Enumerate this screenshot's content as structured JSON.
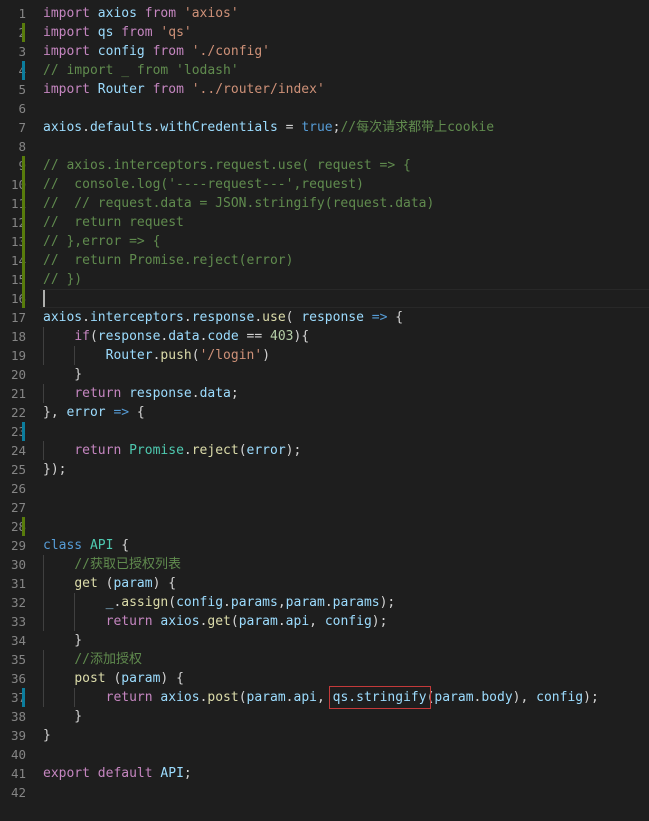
{
  "editor": {
    "lines": [
      {
        "n": "1",
        "marker": "",
        "tokens": [
          {
            "t": "import",
            "c": "kw"
          },
          {
            "t": " "
          },
          {
            "t": "axios",
            "c": "var"
          },
          {
            "t": " "
          },
          {
            "t": "from",
            "c": "kw"
          },
          {
            "t": " "
          },
          {
            "t": "'axios'",
            "c": "str"
          }
        ]
      },
      {
        "n": "2",
        "marker": "add",
        "tokens": [
          {
            "t": "import",
            "c": "kw"
          },
          {
            "t": " "
          },
          {
            "t": "qs",
            "c": "var"
          },
          {
            "t": " "
          },
          {
            "t": "from",
            "c": "kw"
          },
          {
            "t": " "
          },
          {
            "t": "'qs'",
            "c": "str"
          }
        ]
      },
      {
        "n": "3",
        "marker": "",
        "tokens": [
          {
            "t": "import",
            "c": "kw"
          },
          {
            "t": " "
          },
          {
            "t": "config",
            "c": "var"
          },
          {
            "t": " "
          },
          {
            "t": "from",
            "c": "kw"
          },
          {
            "t": " "
          },
          {
            "t": "'./config'",
            "c": "str"
          }
        ]
      },
      {
        "n": "4",
        "marker": "mod",
        "tokens": [
          {
            "t": "// import _ from 'lodash'",
            "c": "cm"
          }
        ]
      },
      {
        "n": "5",
        "marker": "",
        "tokens": [
          {
            "t": "import",
            "c": "kw"
          },
          {
            "t": " "
          },
          {
            "t": "Router",
            "c": "var"
          },
          {
            "t": " "
          },
          {
            "t": "from",
            "c": "kw"
          },
          {
            "t": " "
          },
          {
            "t": "'../router/index'",
            "c": "str"
          }
        ]
      },
      {
        "n": "6",
        "marker": "",
        "tokens": []
      },
      {
        "n": "7",
        "marker": "",
        "tokens": [
          {
            "t": "axios",
            "c": "var"
          },
          {
            "t": "."
          },
          {
            "t": "defaults",
            "c": "var"
          },
          {
            "t": "."
          },
          {
            "t": "withCredentials",
            "c": "var"
          },
          {
            "t": " = "
          },
          {
            "t": "true",
            "c": "kw2"
          },
          {
            "t": ";"
          },
          {
            "t": "//每次请求都带上cookie",
            "c": "cm"
          }
        ]
      },
      {
        "n": "8",
        "marker": "",
        "tokens": []
      },
      {
        "n": "9",
        "marker": "add",
        "tokens": [
          {
            "t": "// axios.interceptors.request.use( request => {",
            "c": "cm"
          }
        ]
      },
      {
        "n": "10",
        "marker": "add",
        "tokens": [
          {
            "t": "//  console.log('----request---',request)",
            "c": "cm"
          }
        ]
      },
      {
        "n": "11",
        "marker": "add",
        "tokens": [
          {
            "t": "//  // request.data = JSON.stringify(request.data)",
            "c": "cm"
          }
        ]
      },
      {
        "n": "12",
        "marker": "add",
        "tokens": [
          {
            "t": "//  return request",
            "c": "cm"
          }
        ]
      },
      {
        "n": "13",
        "marker": "add",
        "tokens": [
          {
            "t": "// },error => {",
            "c": "cm"
          }
        ]
      },
      {
        "n": "14",
        "marker": "add",
        "tokens": [
          {
            "t": "//  return Promise.reject(error)",
            "c": "cm"
          }
        ]
      },
      {
        "n": "15",
        "marker": "add",
        "tokens": [
          {
            "t": "// })",
            "c": "cm"
          }
        ]
      },
      {
        "n": "16",
        "marker": "add",
        "current": true,
        "tokens": []
      },
      {
        "n": "17",
        "marker": "",
        "tokens": [
          {
            "t": "axios",
            "c": "var"
          },
          {
            "t": "."
          },
          {
            "t": "interceptors",
            "c": "var"
          },
          {
            "t": "."
          },
          {
            "t": "response",
            "c": "var"
          },
          {
            "t": "."
          },
          {
            "t": "use",
            "c": "fn"
          },
          {
            "t": "( "
          },
          {
            "t": "response",
            "c": "var"
          },
          {
            "t": " "
          },
          {
            "t": "=>",
            "c": "kw2"
          },
          {
            "t": " {"
          }
        ]
      },
      {
        "n": "18",
        "marker": "",
        "tokens": [
          {
            "t": "    "
          },
          {
            "t": "if",
            "c": "kw"
          },
          {
            "t": "("
          },
          {
            "t": "response",
            "c": "var"
          },
          {
            "t": "."
          },
          {
            "t": "data",
            "c": "var"
          },
          {
            "t": "."
          },
          {
            "t": "code",
            "c": "var"
          },
          {
            "t": " == "
          },
          {
            "t": "403",
            "c": "num"
          },
          {
            "t": "){"
          }
        ]
      },
      {
        "n": "19",
        "marker": "",
        "tokens": [
          {
            "t": "        "
          },
          {
            "t": "Router",
            "c": "var"
          },
          {
            "t": "."
          },
          {
            "t": "push",
            "c": "fn"
          },
          {
            "t": "("
          },
          {
            "t": "'/login'",
            "c": "str"
          },
          {
            "t": ")"
          }
        ]
      },
      {
        "n": "20",
        "marker": "",
        "tokens": [
          {
            "t": "    }"
          }
        ]
      },
      {
        "n": "21",
        "marker": "",
        "tokens": [
          {
            "t": "    "
          },
          {
            "t": "return",
            "c": "kw"
          },
          {
            "t": " "
          },
          {
            "t": "response",
            "c": "var"
          },
          {
            "t": "."
          },
          {
            "t": "data",
            "c": "var"
          },
          {
            "t": ";"
          }
        ]
      },
      {
        "n": "22",
        "marker": "",
        "tokens": [
          {
            "t": "}, "
          },
          {
            "t": "error",
            "c": "var"
          },
          {
            "t": " "
          },
          {
            "t": "=>",
            "c": "kw2"
          },
          {
            "t": " {"
          }
        ]
      },
      {
        "n": "23",
        "marker": "mod",
        "tokens": []
      },
      {
        "n": "24",
        "marker": "",
        "tokens": [
          {
            "t": "    "
          },
          {
            "t": "return",
            "c": "kw"
          },
          {
            "t": " "
          },
          {
            "t": "Promise",
            "c": "cls"
          },
          {
            "t": "."
          },
          {
            "t": "reject",
            "c": "fn"
          },
          {
            "t": "("
          },
          {
            "t": "error",
            "c": "var"
          },
          {
            "t": ");"
          }
        ]
      },
      {
        "n": "25",
        "marker": "",
        "tokens": [
          {
            "t": "});"
          }
        ]
      },
      {
        "n": "26",
        "marker": "",
        "tokens": []
      },
      {
        "n": "27",
        "marker": "",
        "tokens": []
      },
      {
        "n": "28",
        "marker": "add",
        "tokens": []
      },
      {
        "n": "29",
        "marker": "",
        "tokens": [
          {
            "t": "class",
            "c": "kw2"
          },
          {
            "t": " "
          },
          {
            "t": "API",
            "c": "cls"
          },
          {
            "t": " {"
          }
        ]
      },
      {
        "n": "30",
        "marker": "",
        "tokens": [
          {
            "t": "    "
          },
          {
            "t": "//获取已授权列表",
            "c": "cm"
          }
        ]
      },
      {
        "n": "31",
        "marker": "",
        "tokens": [
          {
            "t": "    "
          },
          {
            "t": "get",
            "c": "fn"
          },
          {
            "t": " ("
          },
          {
            "t": "param",
            "c": "var"
          },
          {
            "t": ") {"
          }
        ]
      },
      {
        "n": "32",
        "marker": "",
        "tokens": [
          {
            "t": "        "
          },
          {
            "t": "_",
            "c": "var"
          },
          {
            "t": "."
          },
          {
            "t": "assign",
            "c": "fn"
          },
          {
            "t": "("
          },
          {
            "t": "config",
            "c": "var"
          },
          {
            "t": "."
          },
          {
            "t": "params",
            "c": "var"
          },
          {
            "t": ","
          },
          {
            "t": "param",
            "c": "var"
          },
          {
            "t": "."
          },
          {
            "t": "params",
            "c": "var"
          },
          {
            "t": ");"
          }
        ]
      },
      {
        "n": "33",
        "marker": "",
        "tokens": [
          {
            "t": "        "
          },
          {
            "t": "return",
            "c": "kw"
          },
          {
            "t": " "
          },
          {
            "t": "axios",
            "c": "var"
          },
          {
            "t": "."
          },
          {
            "t": "get",
            "c": "fn"
          },
          {
            "t": "("
          },
          {
            "t": "param",
            "c": "var"
          },
          {
            "t": "."
          },
          {
            "t": "api",
            "c": "var"
          },
          {
            "t": ", "
          },
          {
            "t": "config",
            "c": "var"
          },
          {
            "t": ");"
          }
        ]
      },
      {
        "n": "34",
        "marker": "",
        "tokens": [
          {
            "t": "    }"
          }
        ]
      },
      {
        "n": "35",
        "marker": "",
        "tokens": [
          {
            "t": "    "
          },
          {
            "t": "//添加授权",
            "c": "cm"
          }
        ]
      },
      {
        "n": "36",
        "marker": "",
        "tokens": [
          {
            "t": "    "
          },
          {
            "t": "post",
            "c": "fn"
          },
          {
            "t": " ("
          },
          {
            "t": "param",
            "c": "var"
          },
          {
            "t": ") {"
          }
        ]
      },
      {
        "n": "37",
        "marker": "mod",
        "tokens": [
          {
            "t": "        "
          },
          {
            "t": "return",
            "c": "kw"
          },
          {
            "t": " "
          },
          {
            "t": "axios",
            "c": "var"
          },
          {
            "t": "."
          },
          {
            "t": "post",
            "c": "fn"
          },
          {
            "t": "("
          },
          {
            "t": "param",
            "c": "var"
          },
          {
            "t": "."
          },
          {
            "t": "api",
            "c": "var"
          },
          {
            "t": ", "
          },
          {
            "t": "qs.stringify",
            "c": "var",
            "box": true
          },
          {
            "t": "("
          },
          {
            "t": "param",
            "c": "var"
          },
          {
            "t": "."
          },
          {
            "t": "body",
            "c": "var"
          },
          {
            "t": "), "
          },
          {
            "t": "config",
            "c": "var"
          },
          {
            "t": ");"
          }
        ]
      },
      {
        "n": "38",
        "marker": "",
        "tokens": [
          {
            "t": "    }"
          }
        ]
      },
      {
        "n": "39",
        "marker": "",
        "tokens": [
          {
            "t": "}"
          }
        ]
      },
      {
        "n": "40",
        "marker": "",
        "tokens": []
      },
      {
        "n": "41",
        "marker": "",
        "tokens": [
          {
            "t": "export",
            "c": "kw"
          },
          {
            "t": " "
          },
          {
            "t": "default",
            "c": "kw"
          },
          {
            "t": " "
          },
          {
            "t": "API",
            "c": "var"
          },
          {
            "t": ";"
          }
        ]
      },
      {
        "n": "42",
        "marker": "",
        "tokens": []
      }
    ]
  },
  "colors": {
    "background": "#1e1e1e",
    "keyword": "#c586c0",
    "string": "#ce9178",
    "comment": "#608b4e",
    "highlight_box": "#c43a3a"
  }
}
